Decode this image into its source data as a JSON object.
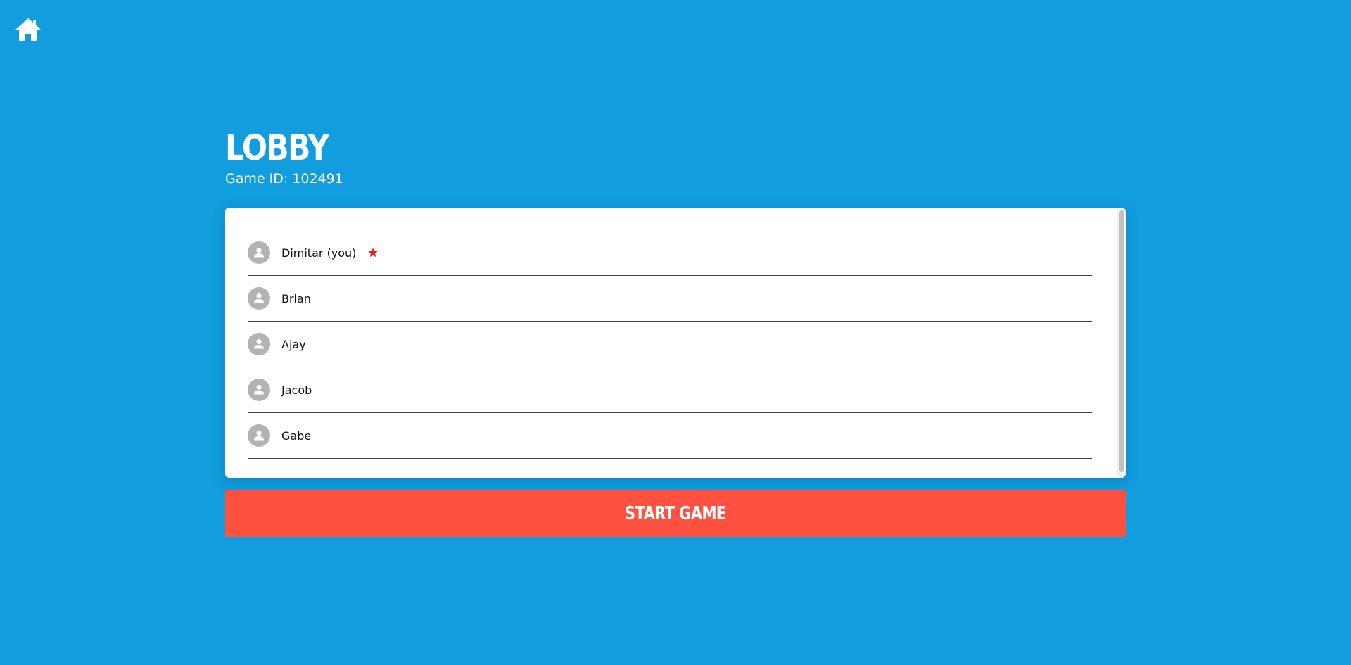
{
  "header": {
    "home_icon": "home-icon",
    "title": "LOBBY",
    "game_id": "Game ID: 102491"
  },
  "players": [
    {
      "name": "Dimitar (you)",
      "is_host": true,
      "avatar_icon": "user-icon"
    },
    {
      "name": "Brian",
      "is_host": false,
      "avatar_icon": "user-icon"
    },
    {
      "name": "Ajay",
      "is_host": false,
      "avatar_icon": "user-icon"
    },
    {
      "name": "Jacob",
      "is_host": false,
      "avatar_icon": "user-icon"
    },
    {
      "name": "Gabe",
      "is_host": false,
      "avatar_icon": "user-icon"
    }
  ],
  "host_icon": "star-icon",
  "actions": {
    "start_label": "START GAME"
  },
  "colors": {
    "background": "#129ddf",
    "start_button": "#ff5040",
    "host_star": "#e51f1f",
    "avatar": "#b3b3b3"
  }
}
